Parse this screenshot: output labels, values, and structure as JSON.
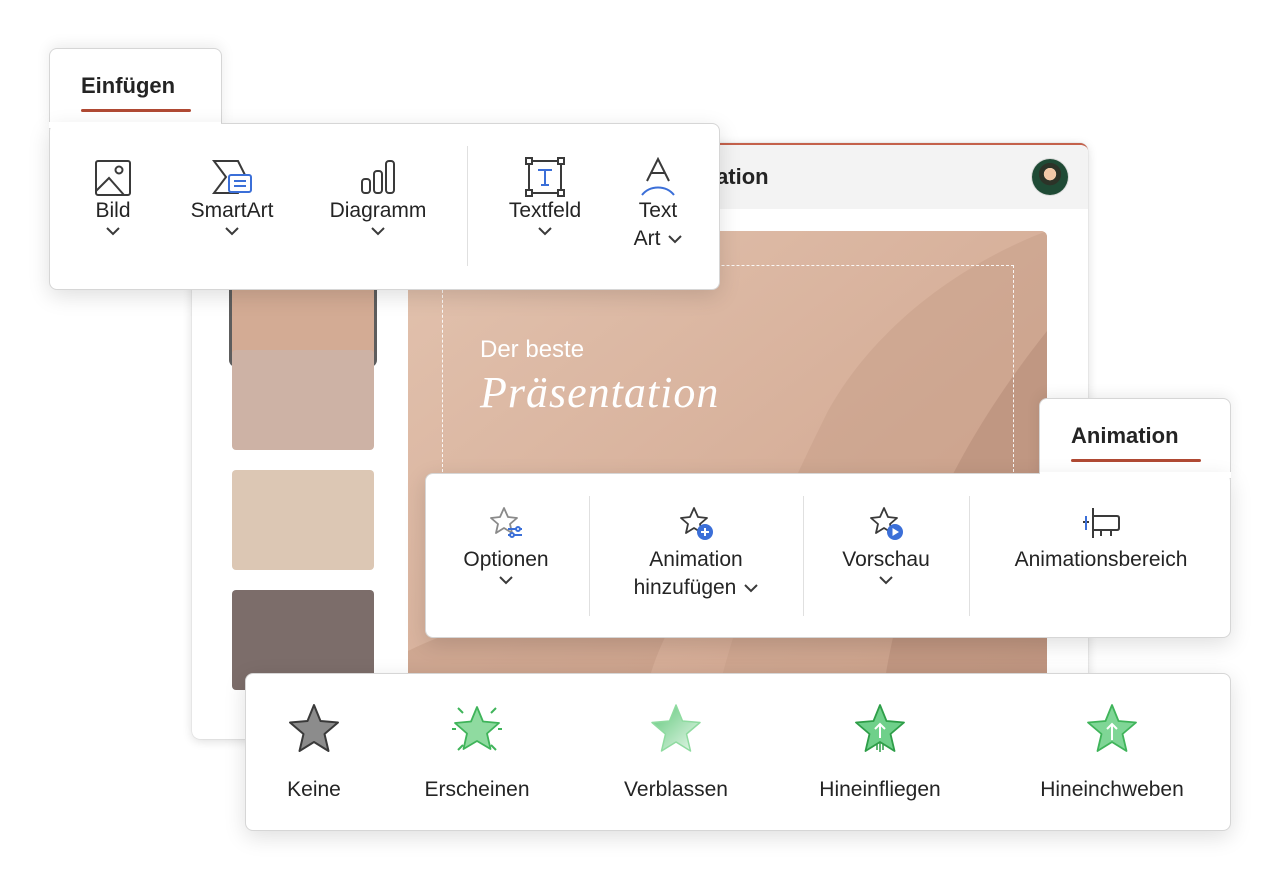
{
  "window": {
    "document_title": "Präsentation",
    "slide": {
      "subtitle": "Der beste",
      "title": "Präsentation"
    },
    "thumbnails": [
      {
        "color": "#d3ab94"
      },
      {
        "color": "#cdb2a5"
      },
      {
        "color": "#dcc7b4"
      },
      {
        "color": "#7c6d6a"
      }
    ]
  },
  "insert_ribbon": {
    "tab_label": "Einfügen",
    "commands": [
      {
        "label": "Bild",
        "icon": "picture-icon"
      },
      {
        "label": "SmartArt",
        "icon": "smartart-icon"
      },
      {
        "label": "Diagramm",
        "icon": "chart-icon"
      },
      {
        "label": "Textfeld",
        "icon": "textbox-icon"
      },
      {
        "label_line1": "Text",
        "label_line2": "Art",
        "icon": "wordart-icon"
      }
    ]
  },
  "animation_ribbon": {
    "tab_label": "Animation",
    "commands": [
      {
        "label": "Optionen",
        "icon": "effect-options-icon"
      },
      {
        "label_line1": "Animation",
        "label_line2": "hinzufügen",
        "icon": "add-animation-icon"
      },
      {
        "label": "Vorschau",
        "icon": "preview-icon"
      },
      {
        "label": "Animationsbereich",
        "icon": "animation-pane-icon"
      }
    ]
  },
  "effects_gallery": {
    "items": [
      {
        "label": "Keine",
        "icon": "star-none-icon"
      },
      {
        "label": "Erscheinen",
        "icon": "star-appear-icon"
      },
      {
        "label": "Verblassen",
        "icon": "star-fade-icon"
      },
      {
        "label": "Hineinfliegen",
        "icon": "star-fly-in-icon"
      },
      {
        "label": "Hineinchweben",
        "icon": "star-float-in-icon"
      }
    ]
  },
  "colors": {
    "accent": "#b04a34",
    "icon_blue": "#3b6fd8",
    "effect_green": "#5fc77a"
  }
}
